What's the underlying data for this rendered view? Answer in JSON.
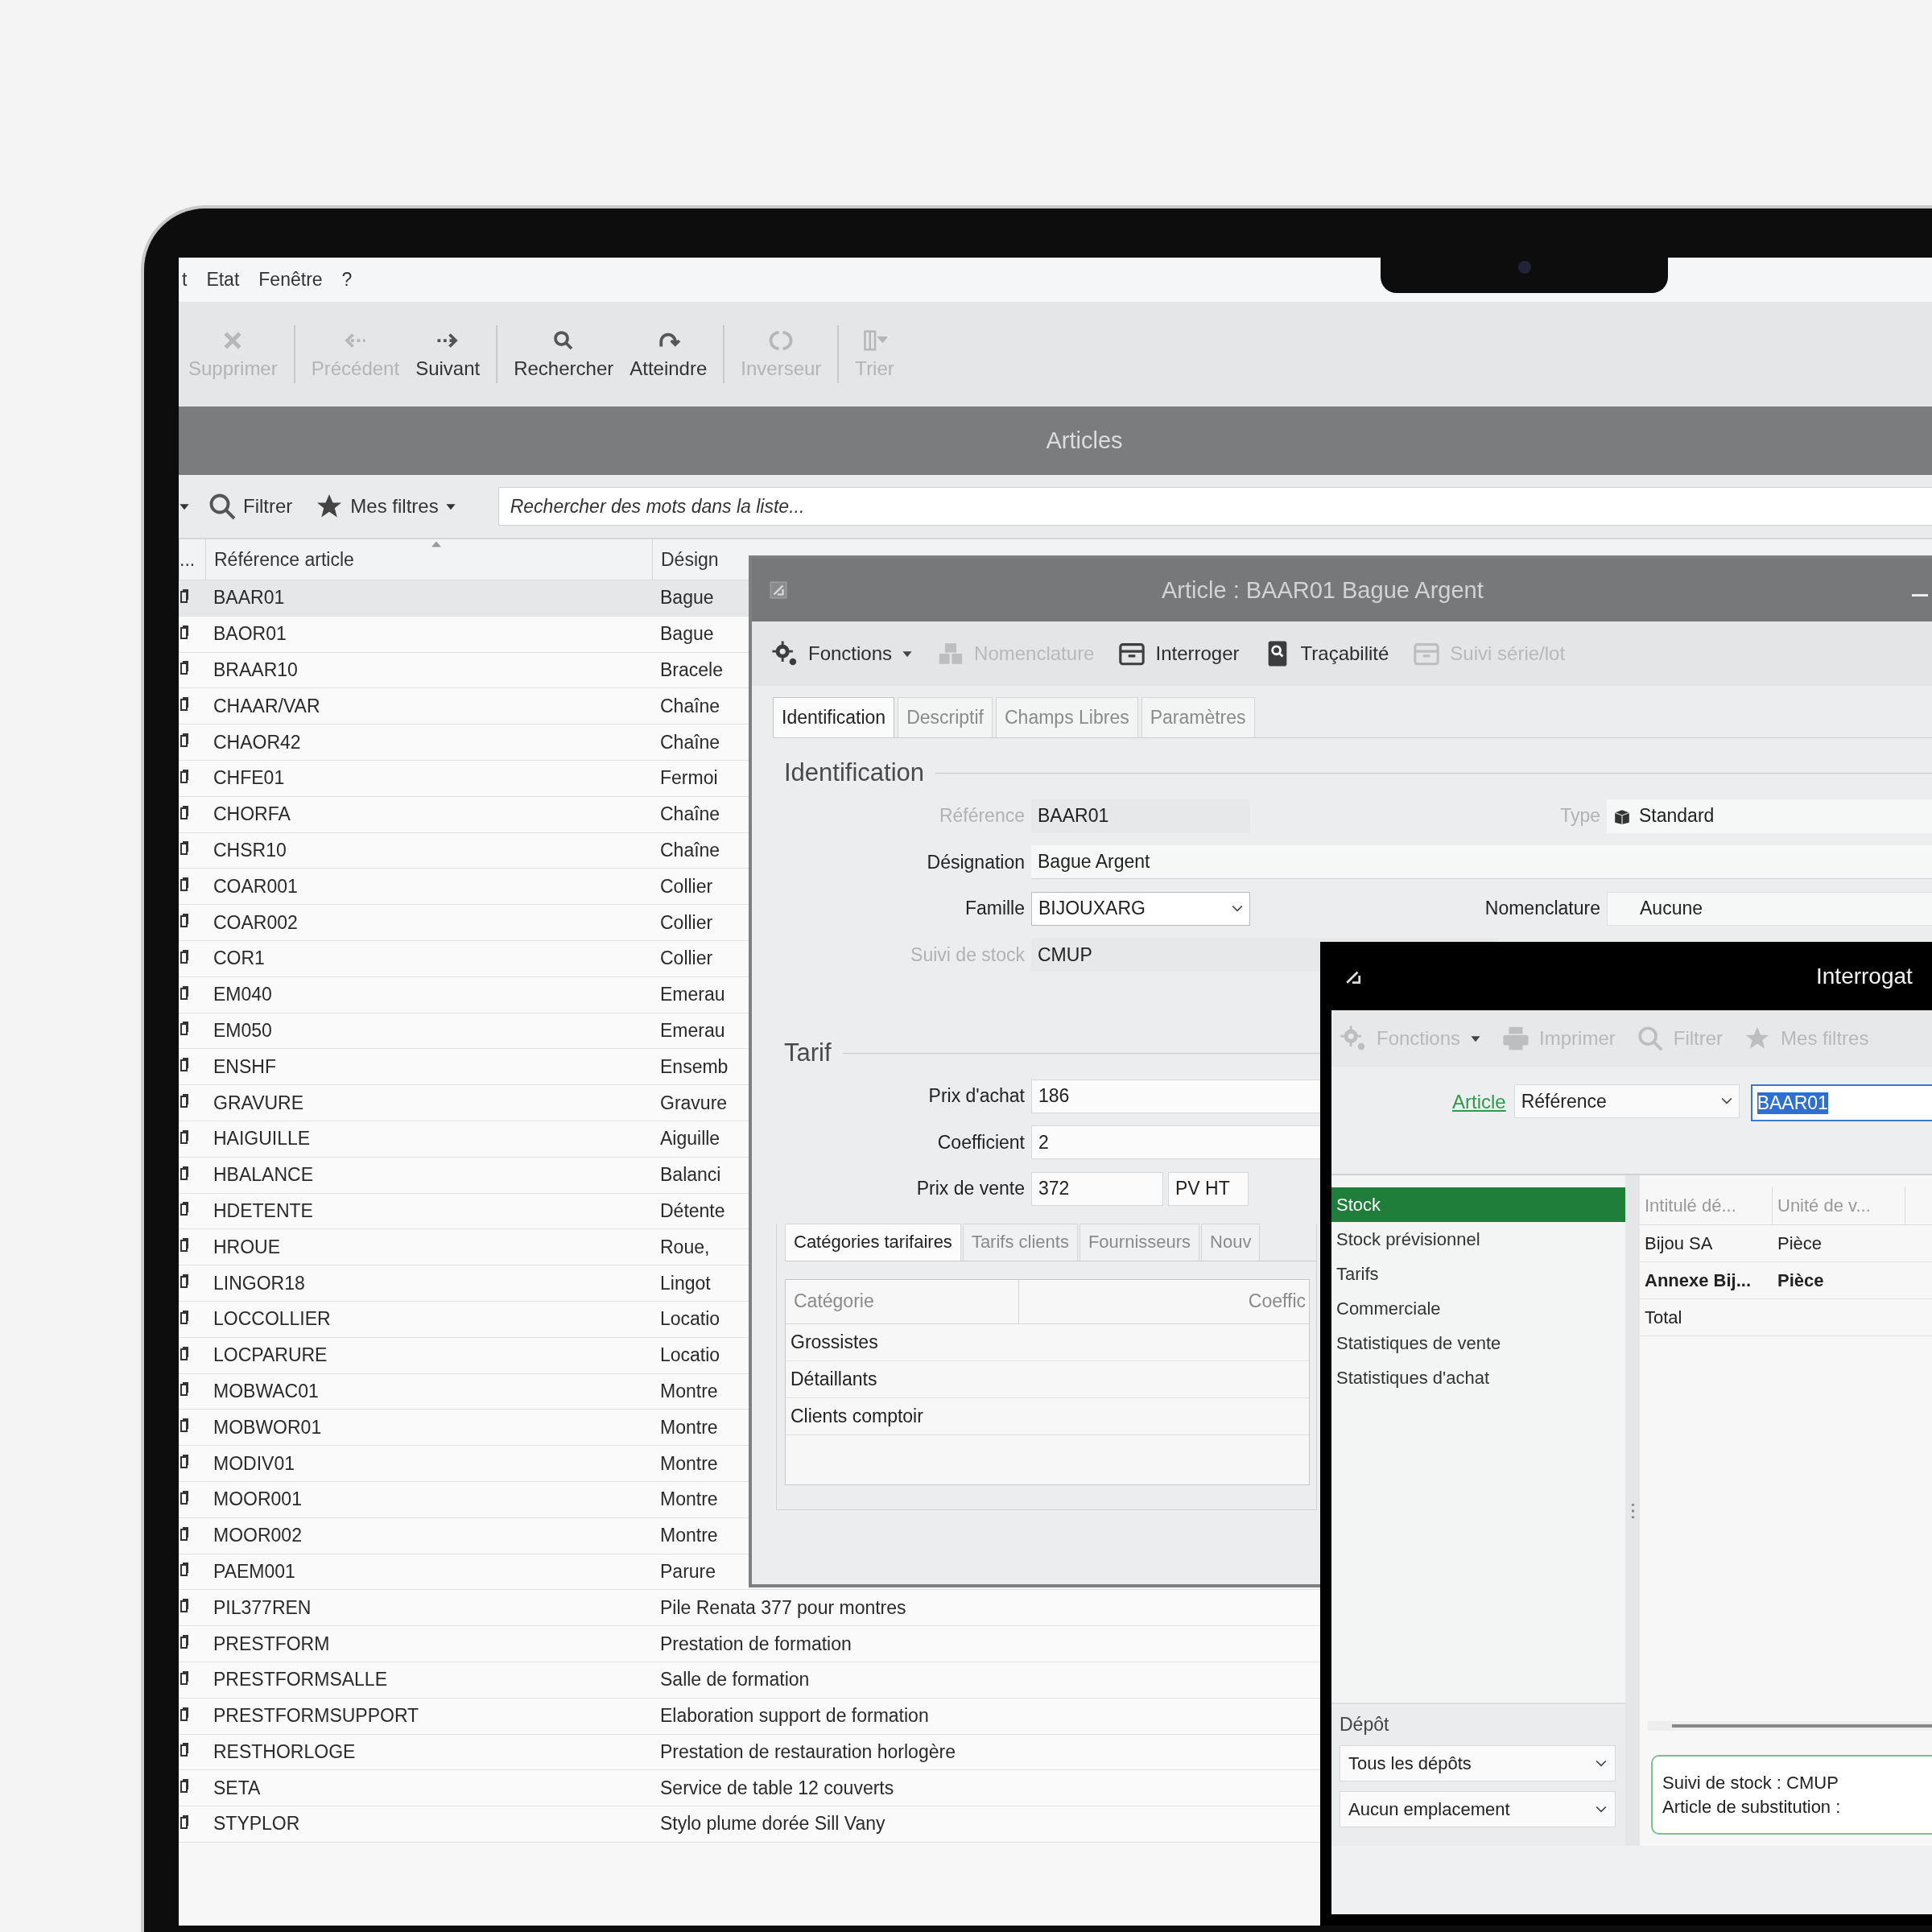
{
  "menu_bar": {
    "items": [
      "t",
      "Etat",
      "Fenêtre",
      "?"
    ]
  },
  "toolbar": {
    "groups": [
      [
        {
          "label": "Supprimer",
          "kind": "delete",
          "disabled": true
        }
      ],
      [
        {
          "label": "Précédent",
          "kind": "previous",
          "disabled": true
        },
        {
          "label": "Suivant",
          "kind": "next",
          "disabled": false
        }
      ],
      [
        {
          "label": "Rechercher",
          "kind": "search",
          "disabled": false
        },
        {
          "label": "Atteindre",
          "kind": "goto",
          "disabled": false
        }
      ],
      [
        {
          "label": "Inverseur",
          "kind": "invert",
          "disabled": true
        }
      ],
      [
        {
          "label": "Trier",
          "kind": "sort",
          "disabled": true
        }
      ]
    ]
  },
  "window_title": "Articles",
  "filter_bar": {
    "filter": "Filtrer",
    "my_filters": "Mes filtres",
    "search": {
      "placeholder": "Rechercher des mots dans la liste..."
    }
  },
  "list": {
    "columns": [
      "...",
      "Référence article",
      "Désign"
    ],
    "rows": [
      {
        "reference": "BAAR01",
        "designation": "Bague",
        "selected": true
      },
      {
        "reference": "BAOR01",
        "designation": "Bague",
        "selected": false
      },
      {
        "reference": "BRAAR10",
        "designation": "Bracele",
        "selected": false
      },
      {
        "reference": "CHAAR/VAR",
        "designation": "Chaîne",
        "selected": false
      },
      {
        "reference": "CHAOR42",
        "designation": "Chaîne",
        "selected": false
      },
      {
        "reference": "CHFE01",
        "designation": "Fermoi",
        "selected": false
      },
      {
        "reference": "CHORFA",
        "designation": "Chaîne",
        "selected": false
      },
      {
        "reference": "CHSR10",
        "designation": "Chaîne",
        "selected": false
      },
      {
        "reference": "COAR001",
        "designation": "Collier",
        "selected": false
      },
      {
        "reference": "COAR002",
        "designation": "Collier",
        "selected": false
      },
      {
        "reference": "COR1",
        "designation": "Collier",
        "selected": false
      },
      {
        "reference": "EM040",
        "designation": "Emerau",
        "selected": false
      },
      {
        "reference": "EM050",
        "designation": "Emerau",
        "selected": false
      },
      {
        "reference": "ENSHF",
        "designation": "Ensemb",
        "selected": false
      },
      {
        "reference": "GRAVURE",
        "designation": "Gravure",
        "selected": false
      },
      {
        "reference": "HAIGUILLE",
        "designation": "Aiguille",
        "selected": false
      },
      {
        "reference": "HBALANCE",
        "designation": "Balanci",
        "selected": false
      },
      {
        "reference": "HDETENTE",
        "designation": "Détente",
        "selected": false
      },
      {
        "reference": "HROUE",
        "designation": "Roue,",
        "selected": false
      },
      {
        "reference": "LINGOR18",
        "designation": "Lingot",
        "selected": false
      },
      {
        "reference": "LOCCOLLIER",
        "designation": "Locatio",
        "selected": false
      },
      {
        "reference": "LOCPARURE",
        "designation": "Locatio",
        "selected": false
      },
      {
        "reference": "MOBWAC01",
        "designation": "Montre",
        "selected": false
      },
      {
        "reference": "MOBWOR01",
        "designation": "Montre",
        "selected": false
      },
      {
        "reference": "MODIV01",
        "designation": "Montre",
        "selected": false
      },
      {
        "reference": "MOOR001",
        "designation": "Montre",
        "selected": false
      },
      {
        "reference": "MOOR002",
        "designation": "Montre",
        "selected": false
      },
      {
        "reference": "PAEM001",
        "designation": "Parure",
        "selected": false
      },
      {
        "reference": "PIL377REN",
        "designation": "Pile Renata 377 pour montres",
        "selected": false
      },
      {
        "reference": "PRESTFORM",
        "designation": "Prestation de formation",
        "selected": false
      },
      {
        "reference": "PRESTFORMSALLE",
        "designation": "Salle de formation",
        "selected": false
      },
      {
        "reference": "PRESTFORMSUPPORT",
        "designation": "Elaboration support de formation",
        "selected": false
      },
      {
        "reference": "RESTHORLOGE",
        "designation": "Prestation de restauration horlogère",
        "selected": false
      },
      {
        "reference": "SETA",
        "designation": "Service de table 12 couverts",
        "selected": false
      },
      {
        "reference": "STYPLOR",
        "designation": "Stylo plume dorée Sill Vany",
        "selected": false
      }
    ]
  },
  "article_dialog": {
    "title": "Article : BAAR01 Bague Argent",
    "toolbar": [
      {
        "label": "Fonctions",
        "kind": "functions",
        "disabled": false
      },
      {
        "label": "Nomenclature",
        "kind": "bom",
        "disabled": true
      },
      {
        "label": "Interroger",
        "kind": "query",
        "disabled": false
      },
      {
        "label": "Traçabilité",
        "kind": "trace",
        "disabled": false
      },
      {
        "label": "Suivi série/lot",
        "kind": "query",
        "disabled": true
      }
    ],
    "tabs": [
      {
        "label": "Identification",
        "selected": true
      },
      {
        "label": "Descriptif",
        "selected": false
      },
      {
        "label": "Champs Libres",
        "selected": false
      },
      {
        "label": "Paramètres",
        "selected": false
      }
    ],
    "identification": {
      "heading": "Identification",
      "fields": [
        {
          "label": "Référence",
          "value": "BAAR01",
          "kind": "text",
          "disabled": true,
          "side": {
            "label": "Type",
            "value": "Standard",
            "kind": "type",
            "disabled": true
          }
        },
        {
          "label": "Désignation",
          "value": "Bague Argent",
          "kind": "text",
          "disabled": false
        },
        {
          "label": "Famille",
          "value": "BIJOUXARG",
          "kind": "select",
          "disabled": false,
          "side": {
            "label": "Nomenclature",
            "value": "Aucune",
            "kind": "text",
            "disabled": false
          }
        },
        {
          "label": "Suivi de stock",
          "value": "CMUP",
          "kind": "text",
          "disabled": true
        }
      ]
    },
    "tarif": {
      "heading": "Tarif",
      "fields": [
        {
          "label": "Prix d'achat",
          "value": "186"
        },
        {
          "label": "Coefficient",
          "value": "2"
        },
        {
          "label": "Prix de vente",
          "value": "372",
          "unit": "PV HT"
        }
      ]
    },
    "subtabs": [
      {
        "label": "Catégories tarifaires",
        "selected": true
      },
      {
        "label": "Tarifs clients",
        "selected": false
      },
      {
        "label": "Fournisseurs",
        "selected": false
      },
      {
        "label": "Nouv",
        "selected": false
      }
    ],
    "table": {
      "columns": [
        "Catégorie",
        "Coeffic"
      ],
      "rows": [
        "Grossistes",
        "Détaillants",
        "Clients comptoir"
      ]
    }
  },
  "query_window": {
    "title": "Interrogat",
    "toolbar": [
      {
        "label": "Fonctions",
        "kind": "functions",
        "disabled": true
      },
      {
        "label": "Imprimer",
        "kind": "print",
        "disabled": true
      },
      {
        "label": "Filtrer",
        "kind": "filter",
        "disabled": true
      },
      {
        "label": "Mes filtres",
        "kind": "star",
        "disabled": true
      }
    ],
    "article_row": {
      "link": "Article",
      "select": "Référence",
      "input": "BAAR01"
    },
    "nav": [
      {
        "label": "Stock",
        "selected": true
      },
      {
        "label": "Stock prévisionnel",
        "selected": false
      },
      {
        "label": "Tarifs",
        "selected": false
      },
      {
        "label": "Commerciale",
        "selected": false
      },
      {
        "label": "Statistiques de vente",
        "selected": false
      },
      {
        "label": "Statistiques d'achat",
        "selected": false
      }
    ],
    "depot": {
      "label": "Dépôt",
      "selects": [
        "Tous les dépôts",
        "Aucun emplacement"
      ]
    },
    "grid": {
      "columns": [
        "Intitulé dé...",
        "Unité de v..."
      ],
      "rows": [
        {
          "cells": [
            "Bijou SA",
            "Pièce"
          ],
          "bold": false
        },
        {
          "cells": [
            "Annexe Bij...",
            "Pièce"
          ],
          "bold": true
        },
        {
          "cells": [
            "Total"
          ],
          "bold": false
        }
      ]
    },
    "info": [
      "Suivi de stock : CMUP",
      "Article de substitution :"
    ]
  }
}
